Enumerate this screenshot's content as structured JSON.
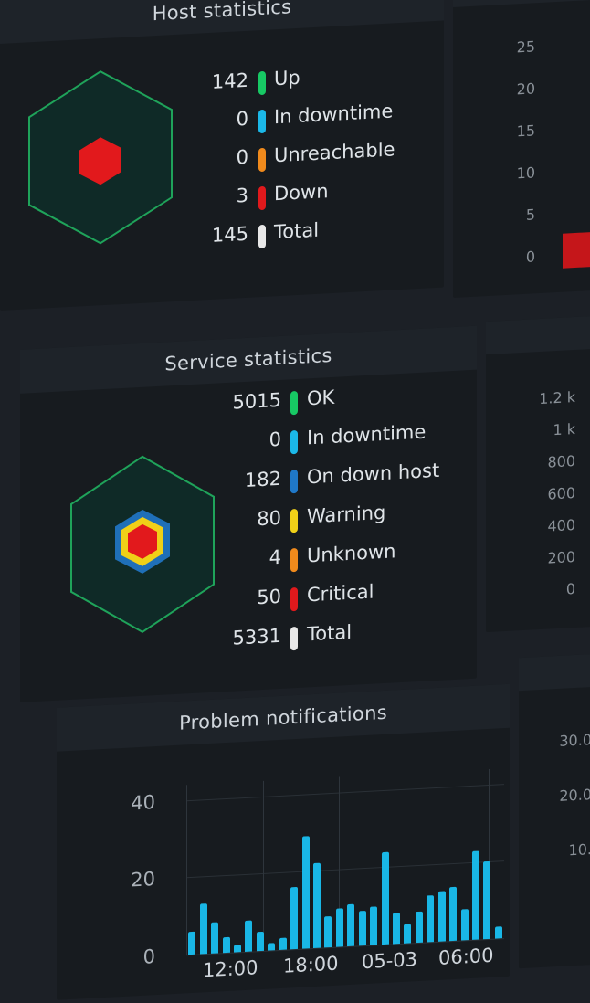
{
  "host": {
    "title": "Host statistics",
    "rows": [
      {
        "count": "142",
        "label": "Up",
        "color": "#17c964"
      },
      {
        "count": "0",
        "label": "In downtime",
        "color": "#1bb8e8"
      },
      {
        "count": "0",
        "label": "Unreachable",
        "color": "#f08a1c"
      },
      {
        "count": "3",
        "label": "Down",
        "color": "#e0191c"
      },
      {
        "count": "145",
        "label": "Total",
        "color": "#e8e8e8"
      }
    ]
  },
  "service": {
    "title": "Service statistics",
    "rows": [
      {
        "count": "5015",
        "label": "OK",
        "color": "#17c964"
      },
      {
        "count": "0",
        "label": "In downtime",
        "color": "#1bb8e8"
      },
      {
        "count": "182",
        "label": "On down host",
        "color": "#1f78c8"
      },
      {
        "count": "80",
        "label": "Warning",
        "color": "#f0d018"
      },
      {
        "count": "4",
        "label": "Unknown",
        "color": "#f08a1c"
      },
      {
        "count": "50",
        "label": "Critical",
        "color": "#e0191c"
      },
      {
        "count": "5331",
        "label": "Total",
        "color": "#e8e8e8"
      }
    ]
  },
  "side_top": {
    "yticks": [
      "25",
      "20",
      "15",
      "10",
      "5",
      "0"
    ]
  },
  "side_mid": {
    "yticks": [
      "1.2 k",
      "1 k",
      "800",
      "600",
      "400",
      "200",
      "0"
    ]
  },
  "side_bottom": {
    "yticks": [
      "30.0",
      "20.0",
      "10."
    ]
  },
  "chart_data": {
    "type": "bar",
    "title": "Problem notifications",
    "yticks": [
      "40",
      "20",
      "0"
    ],
    "ylim": [
      0,
      44
    ],
    "xticks": [
      "12:00",
      "18:00",
      "05-03",
      "06:00"
    ],
    "values": [
      6,
      13,
      8,
      4,
      2,
      8,
      5,
      2,
      3,
      16,
      29,
      22,
      8,
      10,
      11,
      9,
      10,
      24,
      8,
      5,
      8,
      12,
      13,
      14,
      8,
      23,
      20,
      3
    ]
  }
}
